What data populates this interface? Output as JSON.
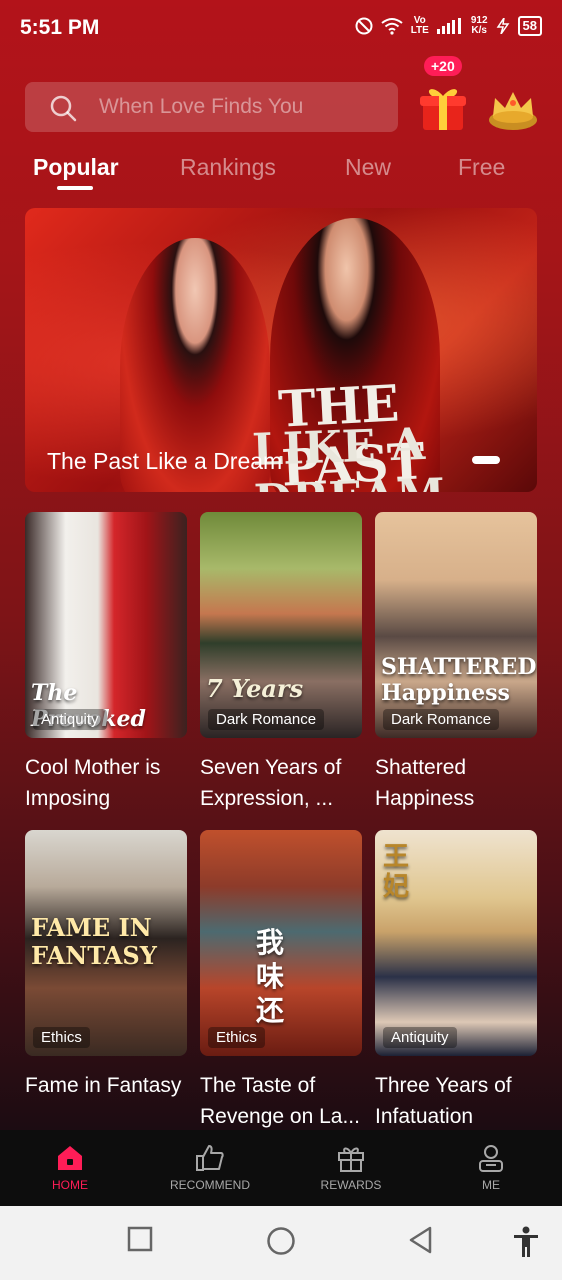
{
  "status_bar": {
    "time": "5:51 PM",
    "net_top": "Vo",
    "net_bottom": "LTE",
    "speed_top": "912",
    "speed_bottom": "K/s",
    "battery": "58"
  },
  "search": {
    "placeholder": "When Love Finds You"
  },
  "gift_badge": "+20",
  "tabs": [
    {
      "label": "Popular"
    },
    {
      "label": "Rankings"
    },
    {
      "label": "New"
    },
    {
      "label": "Free"
    }
  ],
  "banner": {
    "title": "The Past Like a Dream",
    "logo_line1": "THE PAST",
    "logo_line2": "LIKE A DREAM"
  },
  "cards": [
    {
      "title": "Cool Mother is Imposing",
      "tag": "Antiquity",
      "cover_text": "The Provoked"
    },
    {
      "title": "Seven Years of Expression, ...",
      "tag": "Dark Romance",
      "cover_text": "7 Years"
    },
    {
      "title": "Shattered Happiness",
      "tag": "Dark Romance",
      "cover_text": "SHATTERED Happiness"
    },
    {
      "title": "Fame in Fantasy",
      "tag": "Ethics",
      "cover_text": "FAME IN FANTASY"
    },
    {
      "title": "The Taste of Revenge on La...",
      "tag": "Ethics",
      "cover_text": "我味还"
    },
    {
      "title": "Three Years of Infatuation",
      "tag": "Antiquity",
      "cover_text": "王妃"
    }
  ],
  "bottom_nav": [
    {
      "label": "HOME",
      "icon": "home-icon"
    },
    {
      "label": "RECOMMEND",
      "icon": "thumbs-up-icon"
    },
    {
      "label": "REWARDS",
      "icon": "gift-icon"
    },
    {
      "label": "ME",
      "icon": "person-icon"
    }
  ],
  "colors": {
    "accent": "#ff1d57",
    "background_top": "#b3131a",
    "navbar": "#0d0d0d"
  }
}
